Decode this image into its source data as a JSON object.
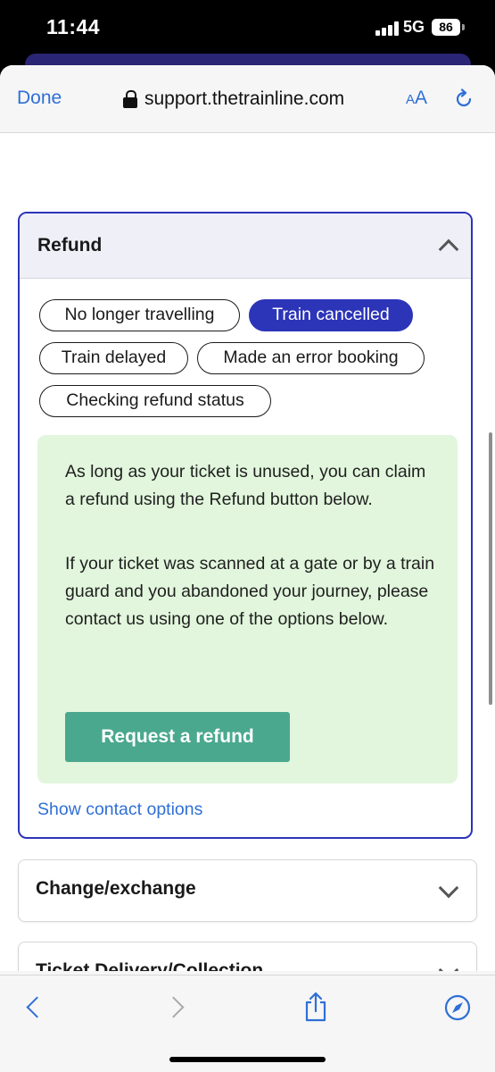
{
  "status_bar": {
    "time": "11:44",
    "network": "5G",
    "battery": "86"
  },
  "browser": {
    "done_label": "Done",
    "url": "support.thetrainline.com",
    "aa_small": "A",
    "aa_large": "A"
  },
  "refund_section": {
    "title": "Refund",
    "pills": [
      {
        "label": "No longer travelling",
        "active": false
      },
      {
        "label": "Train cancelled",
        "active": true
      },
      {
        "label": "Train delayed",
        "active": false
      },
      {
        "label": "Made an error booking",
        "active": false
      },
      {
        "label": "Checking refund status",
        "active": false
      }
    ],
    "info": {
      "paragraph1": "As long as your ticket is unused, you can claim a refund using the Refund button below.",
      "paragraph2": "If your ticket was scanned at a gate or by a train guard and you abandoned your journey, please contact us using one of the options below.",
      "button_label": "Request a refund"
    },
    "contact_link": "Show contact options"
  },
  "accordions": [
    {
      "title": "Change/exchange"
    },
    {
      "title": "Ticket Delivery/Collection"
    }
  ],
  "toolbar": {
    "icons": [
      "back-icon",
      "forward-icon",
      "share-icon",
      "compass-icon"
    ]
  },
  "colors": {
    "accent_blue": "#2c34b8",
    "link_blue": "#2f6fd6",
    "green_box": "#e1f6dc",
    "green_button": "#4aa88e"
  }
}
